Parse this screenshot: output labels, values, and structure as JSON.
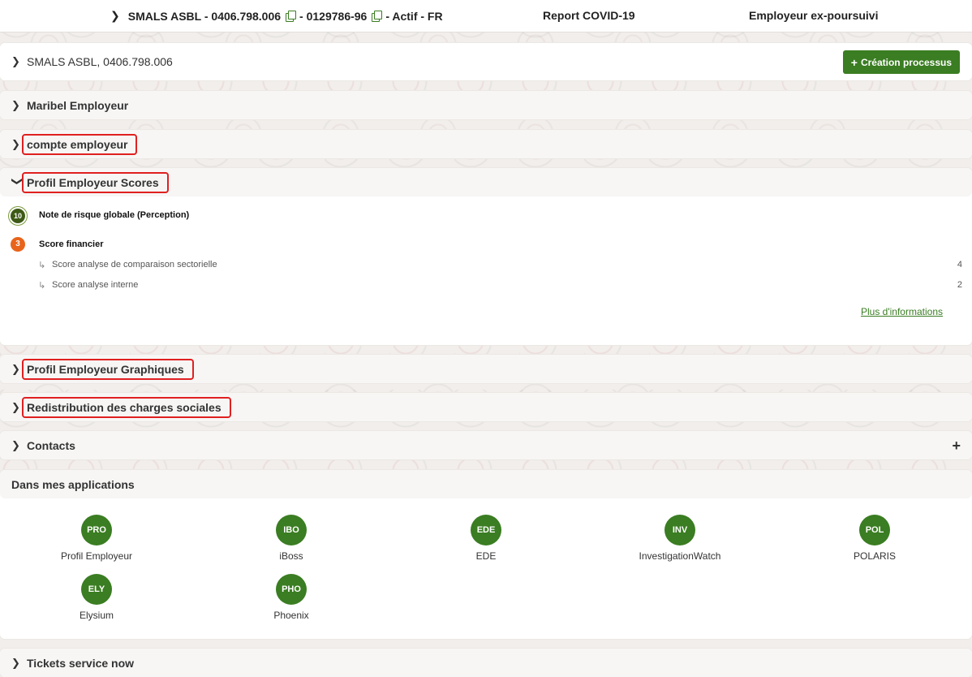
{
  "topbar": {
    "chevron": "›",
    "employer": "SMALS ASBL - 0406.798.006",
    "separator1": "- 0129786-96",
    "status": "- Actif - FR",
    "report": "Report COVID-19",
    "ex": "Employeur ex-poursuivi"
  },
  "panels": {
    "smals": {
      "title": "SMALS ASBL, 0406.798.006",
      "button": "Création processus"
    },
    "maribel": {
      "title": "Maribel Employeur"
    },
    "compte": {
      "title": "compte employeur"
    },
    "scores": {
      "title": "Profil Employeur Scores"
    },
    "graphiques": {
      "title": "Profil Employeur Graphiques"
    },
    "redistribution": {
      "title": "Redistribution des charges sociales"
    },
    "contacts": {
      "title": "Contacts",
      "add": "+"
    },
    "apps": {
      "title": "Dans mes applications"
    },
    "tickets": {
      "title": "Tickets service now"
    }
  },
  "scores": {
    "global": {
      "badge": "10",
      "label": "Note de risque globale (Perception)"
    },
    "financier": {
      "badge": "3",
      "label": "Score financier"
    },
    "subs": [
      {
        "arrow": "↳",
        "label": "Score analyse de comparaison sectorielle",
        "value": "4"
      },
      {
        "arrow": "↳",
        "label": "Score analyse interne",
        "value": "2"
      }
    ],
    "more": "Plus d'informations"
  },
  "apps": [
    {
      "code": "PRO",
      "name": "Profil Employeur"
    },
    {
      "code": "IBO",
      "name": "iBoss"
    },
    {
      "code": "EDE",
      "name": "EDE"
    },
    {
      "code": "INV",
      "name": "InvestigationWatch"
    },
    {
      "code": "POL",
      "name": "POLARIS"
    },
    {
      "code": "ELY",
      "name": "Elysium"
    },
    {
      "code": "PHO",
      "name": "Phoenix"
    }
  ],
  "colors": {
    "accent": "#3a7d22",
    "highlight": "#e02020",
    "orange": "#e8641b"
  },
  "icons": {
    "chevron_right": "›",
    "chevron_down": "⌄",
    "plus": "+",
    "copy": "copy-icon"
  }
}
